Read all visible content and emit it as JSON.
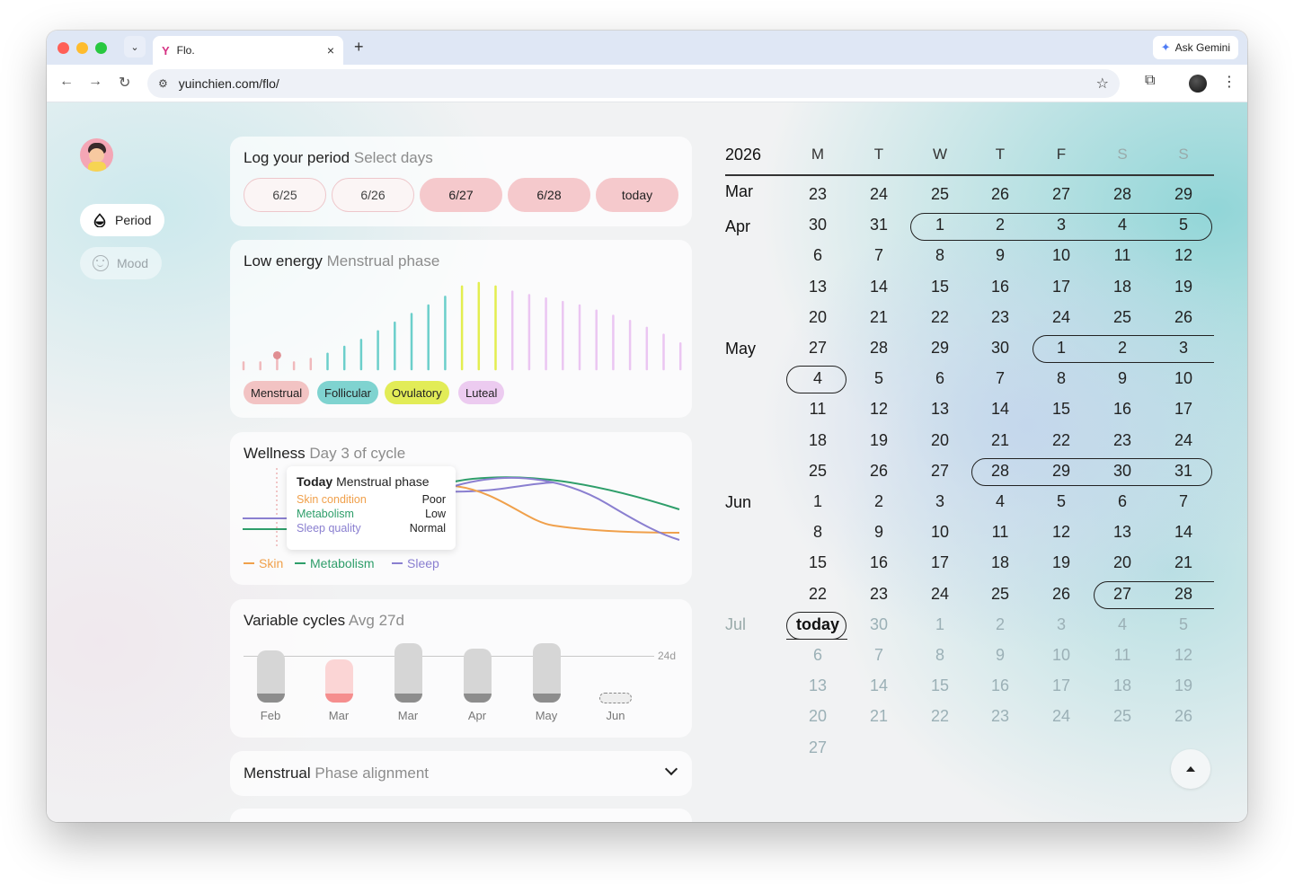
{
  "browser": {
    "tab_title": "Flo.",
    "tab_favicon": "Y",
    "url": "yuinchien.com/flo/",
    "gemini_label": "Ask Gemini"
  },
  "sidebar": {
    "items": [
      {
        "label": "Period",
        "icon": "drop-icon",
        "active": true
      },
      {
        "label": "Mood",
        "icon": "smile-icon",
        "active": false
      }
    ]
  },
  "log_card": {
    "title": "Log your period",
    "subtitle": "Select days",
    "days": [
      {
        "label": "6/25",
        "selected": false
      },
      {
        "label": "6/26",
        "selected": false
      },
      {
        "label": "6/27",
        "selected": true
      },
      {
        "label": "6/28",
        "selected": true
      },
      {
        "label": "today",
        "selected": true
      }
    ]
  },
  "energy_card": {
    "title": "Low energy",
    "subtitle": "Menstrual phase",
    "phases": [
      {
        "label": "Menstrual",
        "color": "#f2c3c3"
      },
      {
        "label": "Follicular",
        "color": "#7fd3d0"
      },
      {
        "label": "Ovulatory",
        "color": "#e2ec57"
      },
      {
        "label": "Luteal",
        "color": "#eccbf0"
      }
    ],
    "bars": [
      0.08,
      0.08,
      0.12,
      0.08,
      0.12,
      0.18,
      0.26,
      0.34,
      0.44,
      0.54,
      0.64,
      0.74,
      0.84,
      0.96,
      1.0,
      0.96,
      0.9,
      0.86,
      0.82,
      0.78,
      0.74,
      0.68,
      0.62,
      0.56,
      0.48,
      0.4,
      0.3,
      0.2
    ],
    "bar_phases": [
      "m",
      "m",
      "m",
      "m",
      "m",
      "f",
      "f",
      "f",
      "f",
      "f",
      "f",
      "f",
      "f",
      "o",
      "o",
      "o",
      "l",
      "l",
      "l",
      "l",
      "l",
      "l",
      "l",
      "l",
      "l",
      "l",
      "l",
      "l"
    ],
    "today_index": 2
  },
  "wellness_card": {
    "title": "Wellness",
    "subtitle": "Day 3 of cycle",
    "tooltip": {
      "head": "Today",
      "phase": "Menstrual phase",
      "rows": [
        {
          "label": "Skin condition",
          "value": "Poor",
          "color": "#f0a04b"
        },
        {
          "label": "Metabolism",
          "value": "Low",
          "color": "#2e9e6a"
        },
        {
          "label": "Sleep quality",
          "value": "Normal",
          "color": "#8a7fd0"
        }
      ]
    },
    "legend": [
      {
        "label": "Skin",
        "color": "#f0a04b"
      },
      {
        "label": "Metabolism",
        "color": "#2e9e6a"
      },
      {
        "label": "Sleep",
        "color": "#8a7fd0"
      }
    ]
  },
  "cycles_card": {
    "title": "Variable cycles",
    "subtitle": "Avg 27d",
    "reference_label": "24d",
    "months": [
      {
        "label": "Feb",
        "type": "past"
      },
      {
        "label": "Mar",
        "type": "highlight"
      },
      {
        "label": "Mar",
        "type": "past"
      },
      {
        "label": "Apr",
        "type": "past"
      },
      {
        "label": "May",
        "type": "past"
      },
      {
        "label": "Jun",
        "type": "current"
      }
    ]
  },
  "alignment_card": {
    "title": "Menstrual",
    "subtitle": "Phase alignment"
  },
  "calendar": {
    "year": "2026",
    "weekdays": [
      "M",
      "T",
      "W",
      "T",
      "F",
      "S",
      "S"
    ],
    "months": [
      {
        "label": "Mar",
        "row": 0
      },
      {
        "label": "Apr",
        "row": 1
      },
      {
        "label": "May",
        "row": 5
      },
      {
        "label": "Jun",
        "row": 10
      },
      {
        "label": "Jul",
        "row": 14
      }
    ],
    "rows": [
      [
        "23",
        "24",
        "25",
        "26",
        "27",
        "28",
        "29"
      ],
      [
        "30",
        "31",
        "1",
        "2",
        "3",
        "4",
        "5"
      ],
      [
        "6",
        "7",
        "8",
        "9",
        "10",
        "11",
        "12"
      ],
      [
        "13",
        "14",
        "15",
        "16",
        "17",
        "18",
        "19"
      ],
      [
        "20",
        "21",
        "22",
        "23",
        "24",
        "25",
        "26"
      ],
      [
        "27",
        "28",
        "29",
        "30",
        "1",
        "2",
        "3"
      ],
      [
        "4",
        "5",
        "6",
        "7",
        "8",
        "9",
        "10"
      ],
      [
        "11",
        "12",
        "13",
        "14",
        "15",
        "16",
        "17"
      ],
      [
        "18",
        "19",
        "20",
        "21",
        "22",
        "23",
        "24"
      ],
      [
        "25",
        "26",
        "27",
        "28",
        "29",
        "30",
        "31"
      ],
      [
        "1",
        "2",
        "3",
        "4",
        "5",
        "6",
        "7"
      ],
      [
        "8",
        "9",
        "10",
        "11",
        "12",
        "13",
        "14"
      ],
      [
        "15",
        "16",
        "17",
        "18",
        "19",
        "20",
        "21"
      ],
      [
        "22",
        "23",
        "24",
        "25",
        "26",
        "27",
        "28"
      ],
      [
        "today",
        "30",
        "1",
        "2",
        "3",
        "4",
        "5"
      ],
      [
        "6",
        "7",
        "8",
        "9",
        "10",
        "11",
        "12"
      ],
      [
        "13",
        "14",
        "15",
        "16",
        "17",
        "18",
        "19"
      ],
      [
        "20",
        "21",
        "22",
        "23",
        "24",
        "25",
        "26"
      ],
      [
        "27"
      ]
    ]
  }
}
